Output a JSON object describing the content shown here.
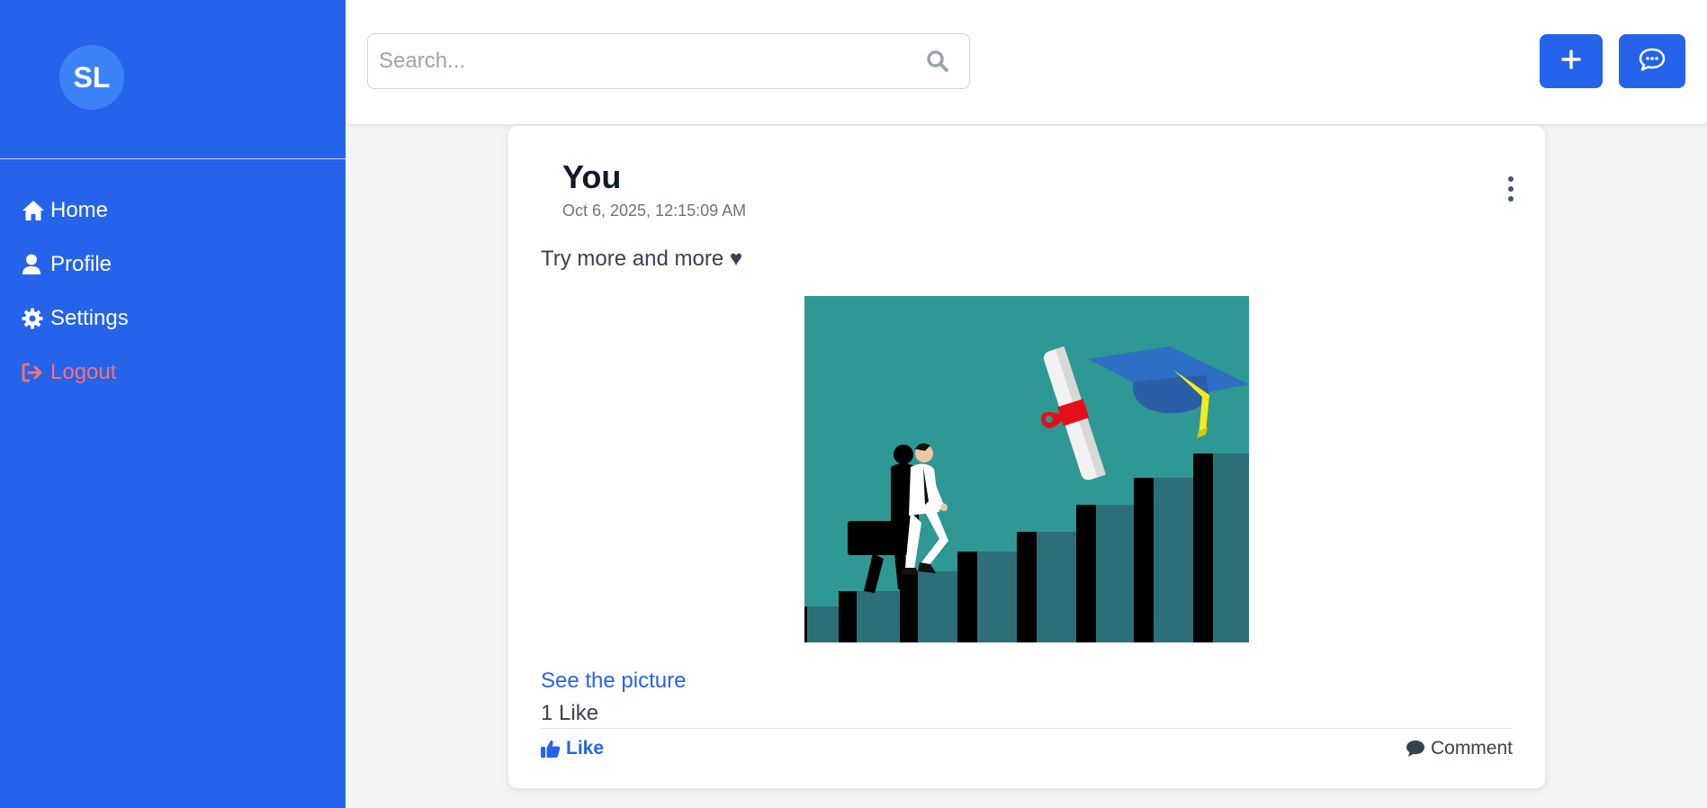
{
  "sidebar": {
    "avatar_initials": "SL",
    "items": [
      {
        "label": "Home",
        "icon": "home-icon"
      },
      {
        "label": "Profile",
        "icon": "user-icon"
      },
      {
        "label": "Settings",
        "icon": "gear-icon"
      },
      {
        "label": "Logout",
        "icon": "logout-icon"
      }
    ]
  },
  "header": {
    "search_placeholder": "Search...",
    "add_icon": "plus-icon",
    "chat_icon": "chat-bubble-icon"
  },
  "post": {
    "author": "You",
    "timestamp": "Oct 6, 2025, 12:15:09 AM",
    "text": "Try more and more ♥",
    "see_picture_label": "See the picture",
    "like_count": "1 Like",
    "like_label": "Like",
    "comment_label": "Comment"
  },
  "colors": {
    "primary": "#2563eb",
    "logout": "#f87171",
    "background": "#f3f4f6"
  }
}
